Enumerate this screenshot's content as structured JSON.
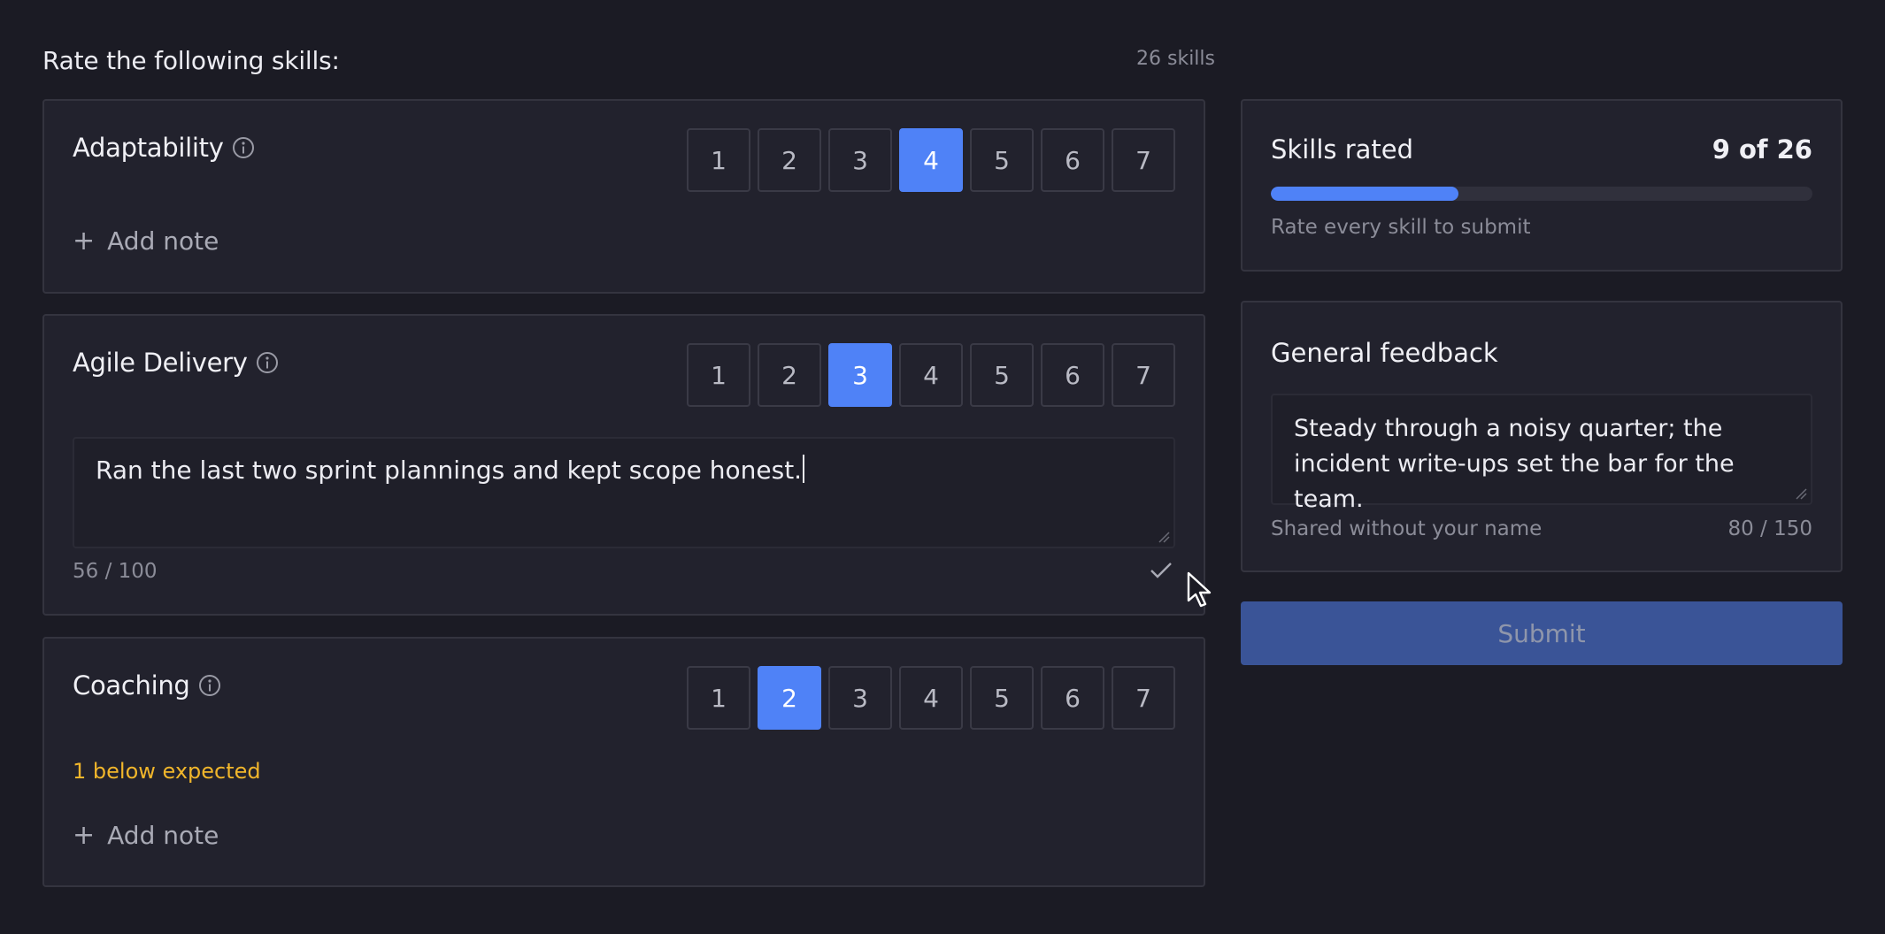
{
  "header": {
    "title": "Rate the following skills:",
    "count": "26 skills"
  },
  "skills": [
    {
      "name": "Adaptability",
      "selected": 4,
      "scale": [
        "1",
        "2",
        "3",
        "4",
        "5",
        "6",
        "7"
      ],
      "add_note": "Add note"
    },
    {
      "name": "Agile Delivery",
      "selected": 3,
      "scale": [
        "1",
        "2",
        "3",
        "4",
        "5",
        "6",
        "7"
      ],
      "note": "Ran the last two sprint plannings and kept scope honest.",
      "char_count": "56 / 100"
    },
    {
      "name": "Coaching",
      "selected": 2,
      "scale": [
        "1",
        "2",
        "3",
        "4",
        "5",
        "6",
        "7"
      ],
      "warning": "1 below expected",
      "add_note": "Add note"
    }
  ],
  "progress": {
    "label": "Skills rated",
    "value": "9 of 26",
    "fraction": 0.346,
    "hint": "Rate every skill to submit"
  },
  "feedback": {
    "label": "General feedback",
    "text": "Steady through a noisy quarter; the incident write-ups set the bar for the team.",
    "shared": "Shared without your name",
    "count": "80 / 150"
  },
  "submit_label": "Submit",
  "colors": {
    "accent": "#4f82f7",
    "warning": "#f1b62b",
    "background": "#1b1b24",
    "card": "#22222d"
  },
  "icons": {
    "info": "info-icon",
    "plus": "plus-icon",
    "check": "check-icon",
    "cursor": "mouse-cursor-icon"
  }
}
